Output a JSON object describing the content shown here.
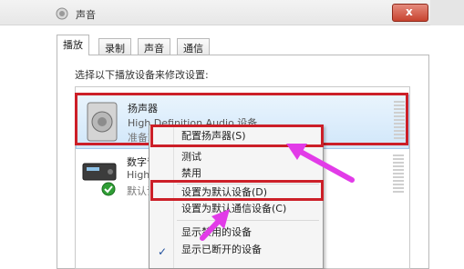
{
  "window": {
    "title": "声音",
    "close_glyph": "x"
  },
  "tabs": [
    {
      "label": "播放"
    },
    {
      "label": "录制"
    },
    {
      "label": "声音"
    },
    {
      "label": "通信"
    }
  ],
  "instruction": "选择以下播放设备来修改设置:",
  "devices": [
    {
      "name": "扬声器",
      "description": "High Definition Audio 设备",
      "state": "准备就绪"
    },
    {
      "name": "数字音",
      "description": "High",
      "state": "默认设"
    }
  ],
  "context_menu": {
    "items": [
      {
        "label": "配置扬声器(S)"
      },
      {
        "label": "测试"
      },
      {
        "label": "禁用"
      },
      {
        "label": "设置为默认设备(D)"
      },
      {
        "label": "设置为默认通信设备(C)"
      },
      {
        "label": "显示禁用的设备"
      },
      {
        "label": "显示已断开的设备",
        "checked": true
      }
    ],
    "check_glyph": "✓"
  },
  "colors": {
    "highlight_box": "#cc1f28",
    "annotation_arrow": "#e23be8",
    "selection": "#d1e7fa"
  }
}
